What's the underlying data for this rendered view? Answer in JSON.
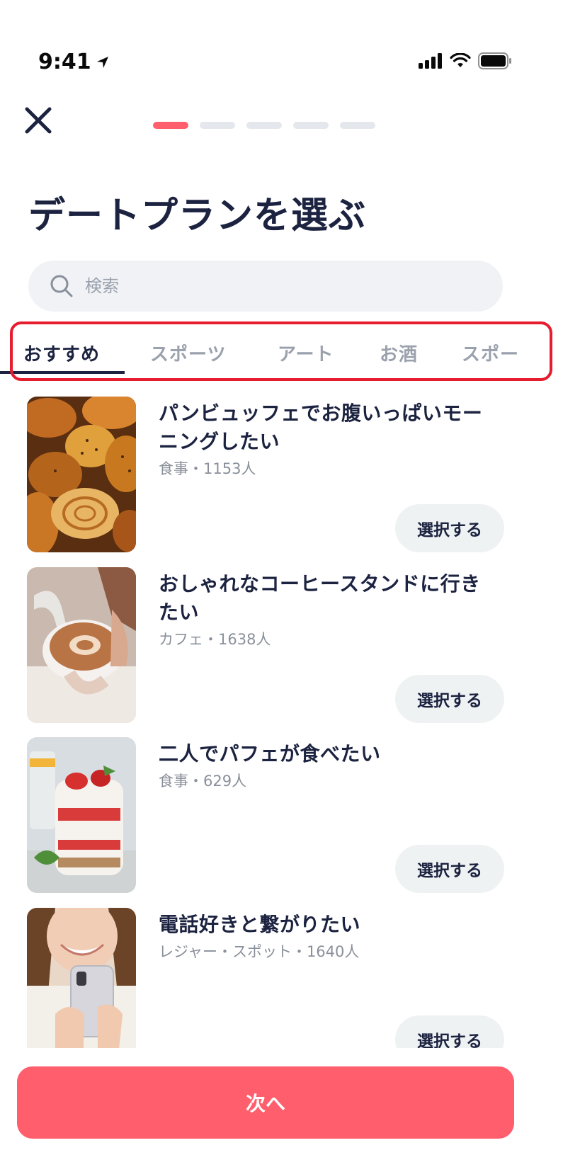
{
  "status_bar": {
    "time": "9:41"
  },
  "header": {
    "progress_steps": 5,
    "active_step": 1
  },
  "page": {
    "title": "デートプランを選ぶ"
  },
  "search": {
    "placeholder": "検索"
  },
  "tabs": [
    {
      "label": "おすすめ",
      "active": true
    },
    {
      "label": "スポーツ",
      "active": false
    },
    {
      "label": "アート",
      "active": false
    },
    {
      "label": "お酒",
      "active": false
    },
    {
      "label": "スポー",
      "active": false
    }
  ],
  "plans": [
    {
      "title": "パンビュッフェでお腹いっぱいモーニングしたい",
      "meta": "食事・1153人",
      "button": "選択する",
      "image": "bread-photo"
    },
    {
      "title": "おしゃれなコーヒースタンドに行きたい",
      "meta": "カフェ・1638人",
      "button": "選択する",
      "image": "latte-photo"
    },
    {
      "title": "二人でパフェが食べたい",
      "meta": "食事・629人",
      "button": "選択する",
      "image": "parfait-photo"
    },
    {
      "title": "電話好きと繋がりたい",
      "meta": "レジャー・スポット・1640人",
      "button": "選択する",
      "image": "phone-woman-photo"
    }
  ],
  "footer": {
    "next_label": "次へ"
  },
  "colors": {
    "accent": "#ff5e6c",
    "text_primary": "#1c2340",
    "text_muted": "#8a909b",
    "highlight": "#e61d2f"
  }
}
